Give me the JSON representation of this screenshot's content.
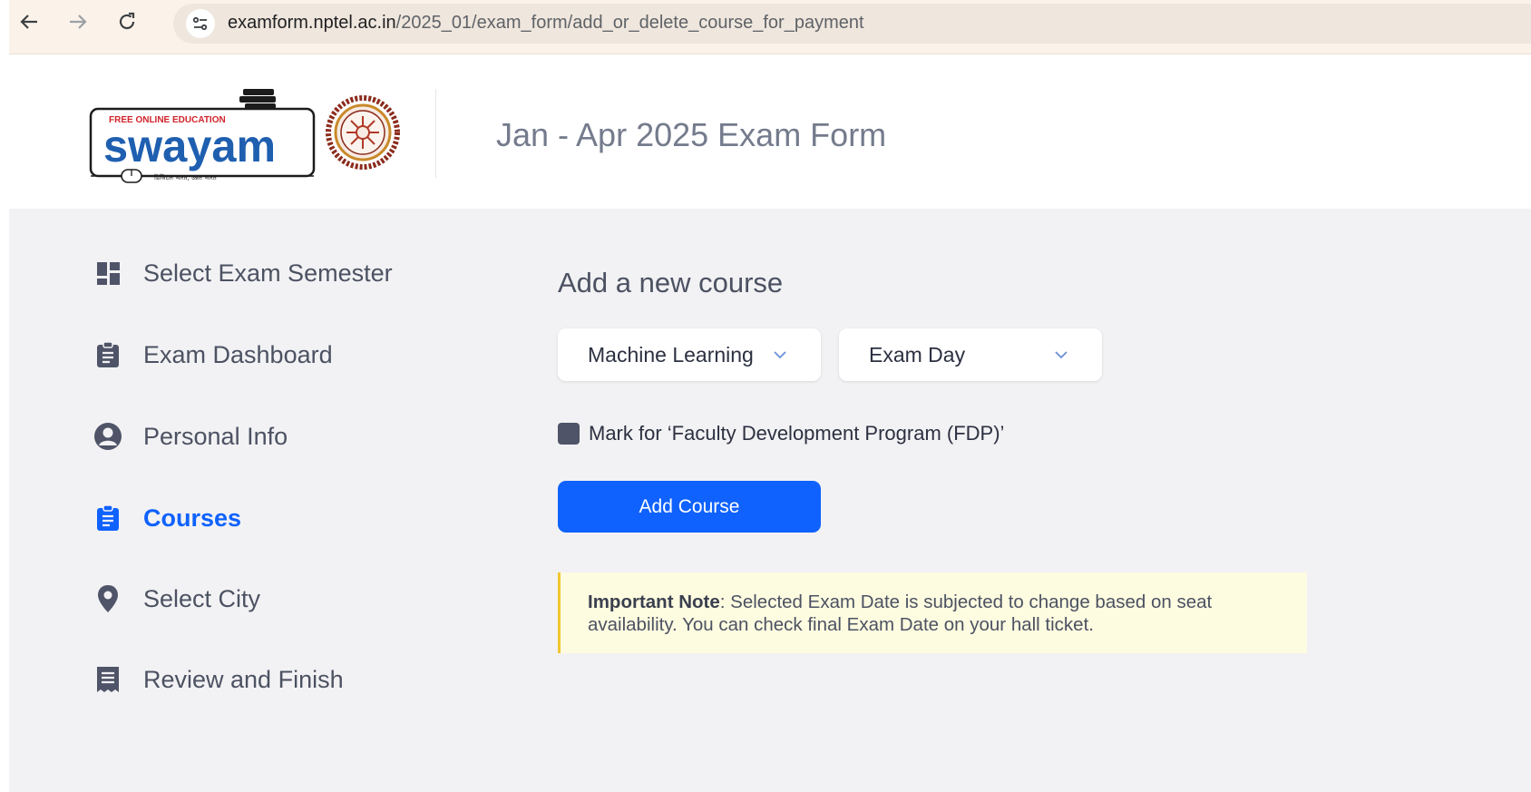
{
  "browser": {
    "url_host": "examform.nptel.ac.in",
    "url_path": "/2025_01/exam_form/add_or_delete_course_for_payment",
    "icons": [
      "back-arrow-icon",
      "forward-arrow-icon",
      "reload-icon",
      "site-info-icon"
    ]
  },
  "header": {
    "logo_tagline": "FREE ONLINE EDUCATION",
    "logo_text": "swayam",
    "logo_subtext": "डिजिटल भारत, उन्नत भारत",
    "title": "Jan - Apr 2025 Exam Form"
  },
  "sidebar": {
    "items": [
      {
        "label": "Select Exam Semester",
        "icon": "dashboard-grid-icon",
        "active": false
      },
      {
        "label": "Exam Dashboard",
        "icon": "clipboard-icon",
        "active": false
      },
      {
        "label": "Personal Info",
        "icon": "user-circle-icon",
        "active": false
      },
      {
        "label": "Courses",
        "icon": "clipboard-icon",
        "active": true
      },
      {
        "label": "Select City",
        "icon": "location-pin-icon",
        "active": false
      },
      {
        "label": "Review and Finish",
        "icon": "receipt-icon",
        "active": false
      }
    ]
  },
  "main": {
    "heading": "Add a new course",
    "course_select": "Machine Learning",
    "exam_day_select": "Exam Day",
    "fdp_label": "Mark for ‘Faculty Development Program (FDP)’",
    "add_button": "Add Course",
    "note_title": "Important Note",
    "note_text": ": Selected Exam Date is subjected to change based on seat availability. You can check final Exam Date on your hall ticket."
  },
  "colors": {
    "accent": "#0f62fe",
    "note_bg": "#fdfbe0",
    "note_border": "#f2c52e",
    "page_bg": "#f2f2f4"
  }
}
